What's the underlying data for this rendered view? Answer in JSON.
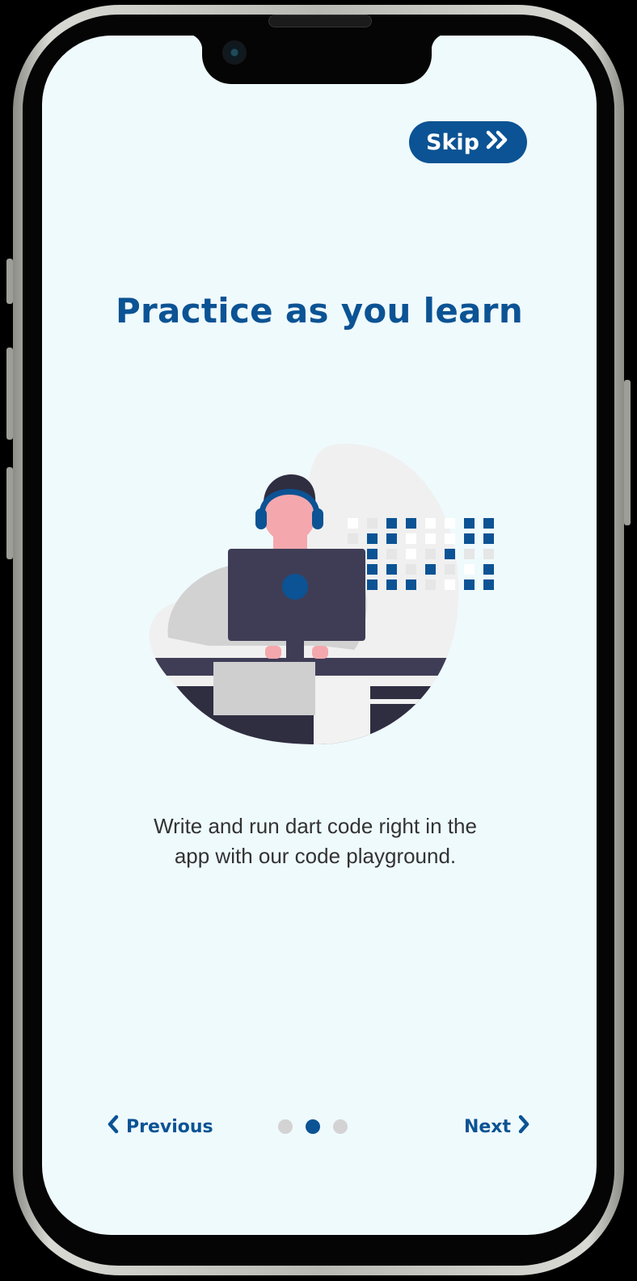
{
  "onboarding": {
    "skip_label": "Skip",
    "title": "Practice as you learn",
    "description_line1": "Write and run dart code right in the",
    "description_line2": "app with our code playground.",
    "previous_label": "Previous",
    "next_label": "Next",
    "pages_total": 3,
    "current_page": 2
  },
  "colors": {
    "accent": "#0b5394",
    "background": "#effafd",
    "inactive_dot": "#d3d3d3"
  },
  "icons": {
    "skip": "double-chevron-right-icon",
    "previous": "chevron-left-icon",
    "next": "chevron-right-icon"
  }
}
